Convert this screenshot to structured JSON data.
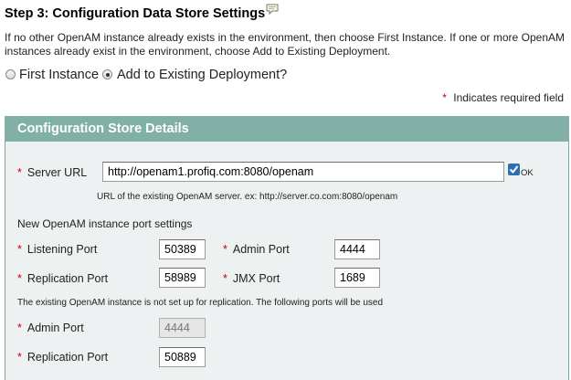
{
  "header": {
    "title": "Step 3: Configuration Data Store Settings",
    "description": "If no other OpenAM instance already exists in the environment, then choose First Instance. If one or more OpenAM instances already exist in the environment, choose Add to Existing Deployment."
  },
  "instance_choice": {
    "first_label": "First Instance",
    "existing_label": "Add to Existing Deployment?",
    "selected": "existing"
  },
  "required_note": {
    "star": "*",
    "text": "Indicates required field"
  },
  "section": {
    "title": "Configuration Store Details",
    "server_url": {
      "label": "Server URL",
      "value": "http://openam1.profiq.com:8080/openam",
      "check_label": "OK",
      "hint": "URL of the existing OpenAM server. ex: http://server.co.com:8080/openam"
    },
    "port_settings_heading": "New OpenAM instance port settings",
    "listening_port": {
      "label": "Listening Port",
      "value": "50389"
    },
    "admin_port": {
      "label": "Admin Port",
      "value": "4444"
    },
    "replication_port": {
      "label": "Replication Port",
      "value": "58989"
    },
    "jmx_port": {
      "label": "JMX Port",
      "value": "1689"
    },
    "replication_note": "The existing OpenAM instance is not set up for replication. The following ports will be used",
    "existing_admin_port": {
      "label": "Admin Port",
      "value": "4444"
    },
    "existing_replication_port": {
      "label": "Replication Port",
      "value": "50889"
    }
  },
  "colors": {
    "section_header": "#80b0a6",
    "section_body": "#eef1f1",
    "required_star": "#cc0000"
  }
}
